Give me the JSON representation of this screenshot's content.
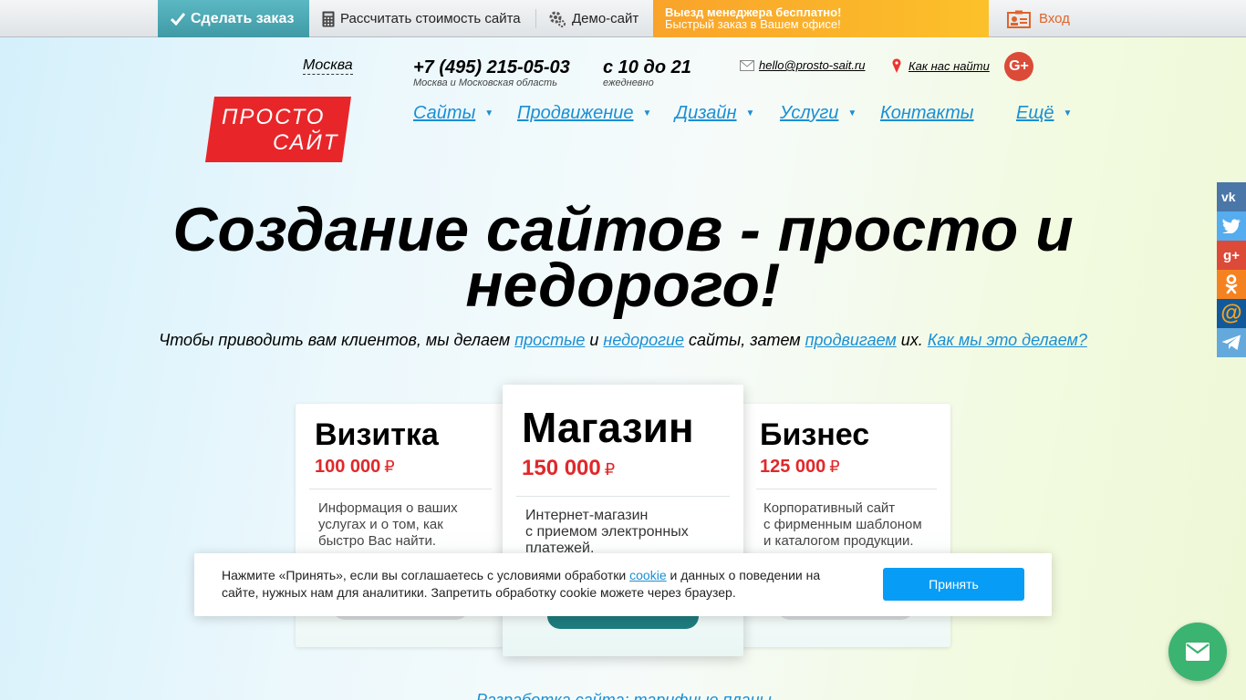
{
  "topbar": {
    "order_label": "Сделать заказ",
    "calc_label": "Рассчитать стоимость сайта",
    "demo_label": "Демо-сайт",
    "promo_line1": "Выезд менеджера бесплатно!",
    "promo_line2": "Быстрый заказ в Вашем офисе!",
    "login_label": "Вход"
  },
  "header": {
    "city": "Москва",
    "phone": "+7 (495) 215-05-03",
    "phone_note": "Москва и Московская область",
    "hours": "с 10 до 21",
    "hours_note": "ежедневно",
    "email": "hello@prosto-sait.ru",
    "find_us": "Как нас найти",
    "gplus": "G+",
    "logo_line1": "ПРОСТО",
    "logo_line2": "САЙТ"
  },
  "nav": [
    {
      "label": "Сайты",
      "has_dropdown": true
    },
    {
      "label": "Продвижение",
      "has_dropdown": true
    },
    {
      "label": "Дизайн",
      "has_dropdown": true
    },
    {
      "label": "Услуги",
      "has_dropdown": true
    },
    {
      "label": "Контакты",
      "has_dropdown": false
    },
    {
      "label": "Ещё",
      "has_dropdown": true
    }
  ],
  "hero": {
    "title": "Создание сайтов - просто и недорого!",
    "sub_part1": "Чтобы приводить вам клиентов, мы делаем",
    "sub_link1": "простые",
    "sub_part2": "и",
    "sub_link2": "недорогие",
    "sub_part3": "сайты, затем",
    "sub_link3": "продвигаем",
    "sub_part4": "их.",
    "sub_link4": "Как мы это делаем?"
  },
  "plans": [
    {
      "title": "Визитка",
      "price": "100 000",
      "currency": "₽",
      "desc": [
        "Информация о ваших",
        "услугах и о том, как",
        "быстро Вас найти."
      ]
    },
    {
      "title": "Магазин",
      "price": "150 000",
      "currency": "₽",
      "desc": [
        "Интернет-магазин",
        "с приемом электронных",
        "платежей."
      ]
    },
    {
      "title": "Бизнес",
      "price": "125 000",
      "currency": "₽",
      "desc": [
        "Корпоративный сайт",
        "с фирменным шаблоном",
        "и каталогом продукции."
      ]
    }
  ],
  "cookie": {
    "text_part1": "Нажмите «Принять», если вы соглашаетесь с условиями обработки",
    "text_link": "cookie",
    "text_part2": "и данных о поведении на сайте, нужных нам для аналитики. Запретить обработку cookie можете через браузер.",
    "accept_label": "Принять"
  },
  "footer_link": "Разработка сайта: тарифные планы",
  "social": [
    {
      "icon": "vk-icon",
      "glyph": "vk",
      "color": "#4a76a8"
    },
    {
      "icon": "twitter-icon",
      "glyph": "t",
      "color": "#55acee"
    },
    {
      "icon": "gplus-icon",
      "glyph": "g+",
      "color": "#dc4a38"
    },
    {
      "icon": "odnoklassniki-icon",
      "glyph": "ok",
      "color": "#f58220"
    },
    {
      "icon": "mail-ru-icon",
      "glyph": "@",
      "color": "#168de2"
    },
    {
      "icon": "telegram-icon",
      "glyph": "tg",
      "color": "#64a9dc"
    }
  ],
  "colors": {
    "accent_blue": "#1a8fd4",
    "price_red": "#e0282a",
    "order_teal": "#4aa8b3",
    "promo_orange": "#fbb32a",
    "accept_blue": "#079cf5",
    "fab_green": "#3bb371",
    "logo_red": "#e8262a"
  }
}
